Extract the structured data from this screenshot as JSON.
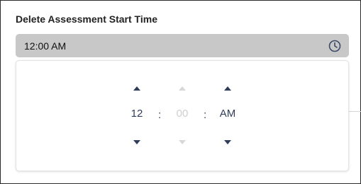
{
  "field": {
    "label": "Delete Assessment Start Time",
    "value": "12:00 AM",
    "icon": "clock-icon"
  },
  "picker": {
    "hour": {
      "value": "12",
      "enabled": true
    },
    "separator1": ":",
    "minute": {
      "value": "00",
      "enabled": false
    },
    "separator2": ":",
    "period": {
      "value": "AM",
      "enabled": true
    }
  },
  "colors": {
    "accent": "#2f3d58",
    "disabled": "#d8d8d8",
    "input_bg": "#c8c8c8"
  }
}
